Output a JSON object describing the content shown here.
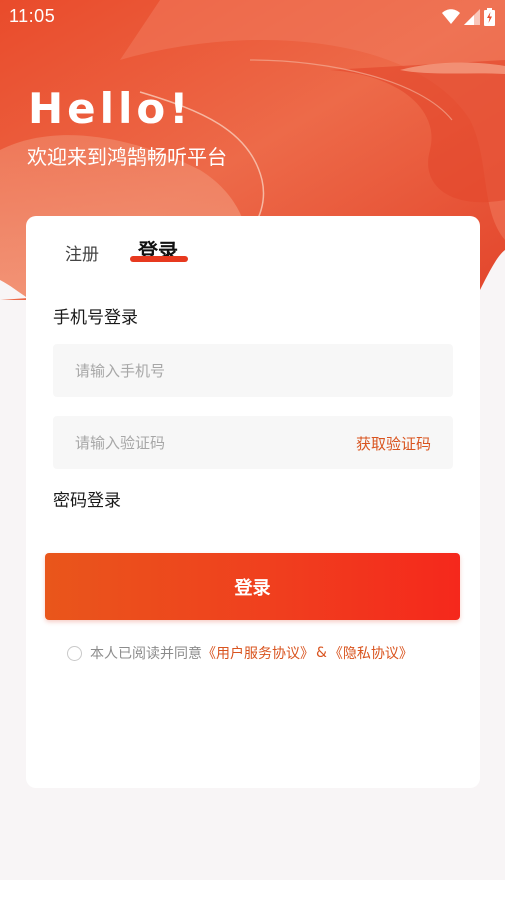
{
  "status_bar": {
    "time": "11:05",
    "icons": [
      "wifi-icon",
      "cell-signal-icon",
      "battery-charging-icon"
    ]
  },
  "header": {
    "greeting": "Hello!",
    "welcome": "欢迎来到鸿鹄畅听平台"
  },
  "tabs": {
    "register": "注册",
    "login": "登录",
    "active": "login"
  },
  "form": {
    "phone_login_label": "手机号登录",
    "phone_placeholder": "请输入手机号",
    "code_placeholder": "请输入验证码",
    "get_code": "获取验证码",
    "password_login_label": "密码登录",
    "submit": "登录"
  },
  "agreement": {
    "checked": false,
    "prefix": "本人已阅读并同意",
    "user_agreement": "《用户服务协议》",
    "ampersand": "&",
    "privacy_policy": "《隐私协议》"
  },
  "colors": {
    "accent": "#E7391F",
    "link": "#D9541F",
    "button_start": "#E9561B",
    "button_end": "#F5281C"
  }
}
